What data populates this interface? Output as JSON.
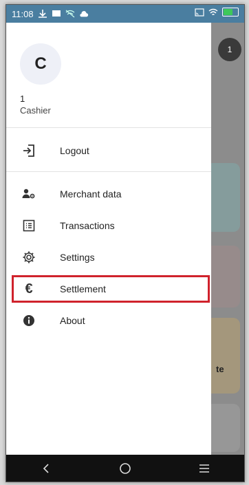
{
  "status_bar": {
    "time": "11:08"
  },
  "background": {
    "badge": "1",
    "partial_text": "te"
  },
  "drawer": {
    "avatar_letter": "C",
    "user_id": "1",
    "user_role": "Cashier",
    "items": [
      {
        "label": "Logout",
        "icon": "logout-icon"
      },
      {
        "label": "Merchant data",
        "icon": "merchant-data-icon"
      },
      {
        "label": "Transactions",
        "icon": "transactions-icon"
      },
      {
        "label": "Settings",
        "icon": "settings-icon"
      },
      {
        "label": "Settlement",
        "icon": "euro-icon"
      },
      {
        "label": "About",
        "icon": "info-icon"
      }
    ]
  },
  "colors": {
    "highlight": "#d0222c",
    "status_bar": "#4a7ea0"
  }
}
